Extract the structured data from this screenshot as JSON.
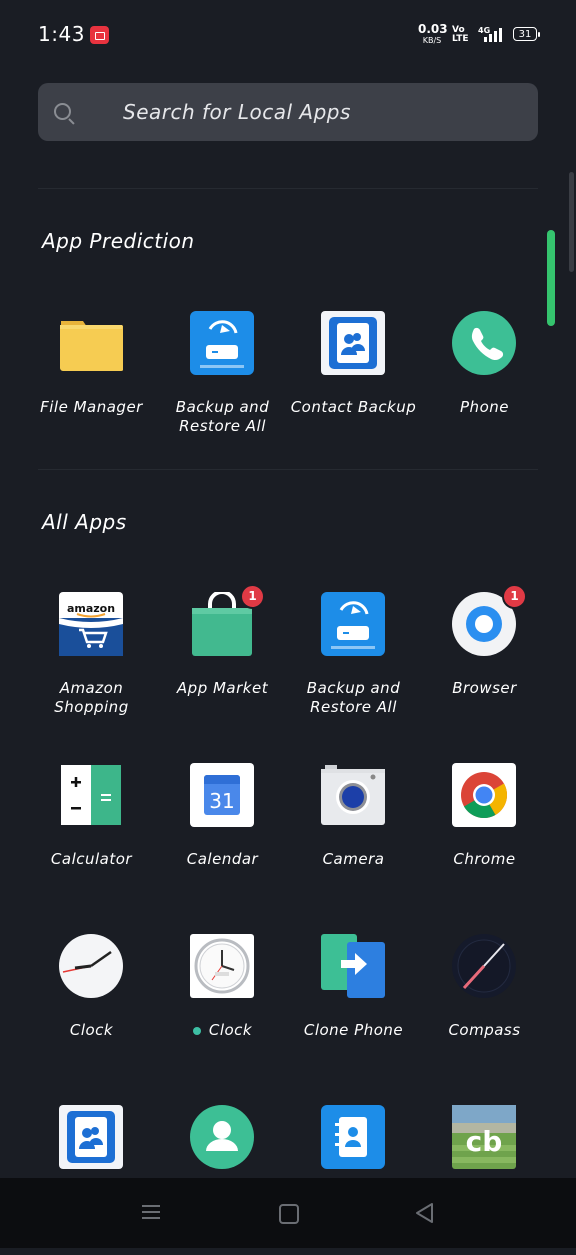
{
  "status_bar": {
    "time": "1:43",
    "net_speed_value": "0.03",
    "net_speed_unit": "KB/S",
    "volte_top": "Vo",
    "volte_bottom": "LTE",
    "network_type": "4G",
    "battery": "31"
  },
  "search": {
    "placeholder": "Search for Local Apps"
  },
  "sections": {
    "prediction_title": "App Prediction",
    "all_apps_title": "All Apps"
  },
  "prediction_apps": [
    {
      "label": "File Manager",
      "icon": "folder-icon"
    },
    {
      "label": "Backup and Restore All",
      "icon": "backup-icon"
    },
    {
      "label": "Contact Backup",
      "icon": "contact-backup-icon"
    },
    {
      "label": "Phone",
      "icon": "phone-icon"
    }
  ],
  "all_apps": [
    {
      "label": "Amazon Shopping",
      "icon": "amazon-icon",
      "badge": null
    },
    {
      "label": "App Market",
      "icon": "shopping-bag-icon",
      "badge": "1"
    },
    {
      "label": "Backup and Restore All",
      "icon": "backup-icon",
      "badge": null
    },
    {
      "label": "Browser",
      "icon": "browser-icon",
      "badge": "1"
    },
    {
      "label": "Calculator",
      "icon": "calculator-icon",
      "badge": null
    },
    {
      "label": "Calendar",
      "icon": "calendar-icon",
      "badge": null,
      "day": "31"
    },
    {
      "label": "Camera",
      "icon": "camera-icon",
      "badge": null
    },
    {
      "label": "Chrome",
      "icon": "chrome-icon",
      "badge": null
    },
    {
      "label": "Clock",
      "icon": "clock-icon",
      "badge": null
    },
    {
      "label": "Clock",
      "icon": "analog-clock-icon",
      "badge": null,
      "new_dot": true
    },
    {
      "label": "Clone Phone",
      "icon": "clone-phone-icon",
      "badge": null
    },
    {
      "label": "Compass",
      "icon": "compass-icon",
      "badge": null
    },
    {
      "label": "",
      "icon": "contacts-book-icon"
    },
    {
      "label": "",
      "icon": "contact-person-icon"
    },
    {
      "label": "",
      "icon": "contacts-blue-icon"
    },
    {
      "label": "",
      "icon": "cricbuzz-icon",
      "text": "cb"
    }
  ],
  "colors": {
    "background": "#1a1d24",
    "search_bg": "#3d4048",
    "accent_green": "#35c46e",
    "badge_red": "#e03a45"
  }
}
